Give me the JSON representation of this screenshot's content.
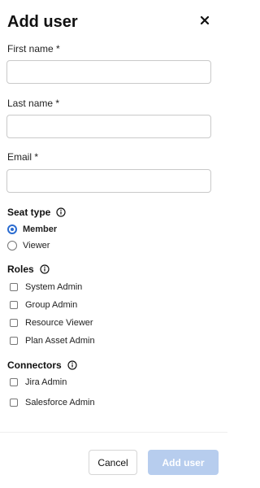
{
  "dialog": {
    "title": "Add user",
    "close_icon": "close-icon"
  },
  "fields": {
    "first_name": {
      "label": "First name *",
      "value": "",
      "placeholder": ""
    },
    "last_name": {
      "label": "Last name *",
      "value": "",
      "placeholder": ""
    },
    "email": {
      "label": "Email *",
      "value": "",
      "placeholder": ""
    }
  },
  "seat_type": {
    "title": "Seat type",
    "info_icon": "info-icon",
    "options": [
      {
        "label": "Member",
        "selected": true
      },
      {
        "label": "Viewer",
        "selected": false
      }
    ]
  },
  "roles": {
    "title": "Roles",
    "info_icon": "info-icon",
    "items": [
      {
        "label": "System Admin",
        "checked": false
      },
      {
        "label": "Group Admin",
        "checked": false
      },
      {
        "label": "Resource Viewer",
        "checked": false
      },
      {
        "label": "Plan Asset Admin",
        "checked": false
      }
    ]
  },
  "connectors": {
    "title": "Connectors",
    "info_icon": "info-icon",
    "items": [
      {
        "label": "Jira Admin",
        "checked": false
      },
      {
        "label": "Salesforce Admin",
        "checked": false
      }
    ]
  },
  "footer": {
    "cancel_label": "Cancel",
    "add_label": "Add user"
  },
  "colors": {
    "accent": "#2b6cd0",
    "primary_disabled": "#b7cdee"
  }
}
